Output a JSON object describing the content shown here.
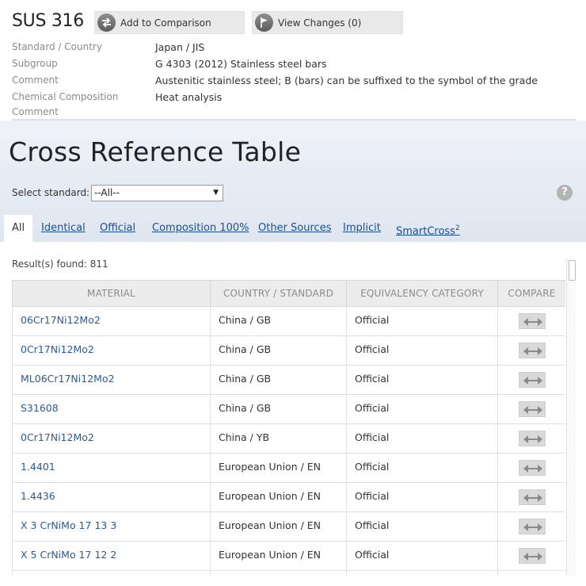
{
  "header": {
    "title": "SUS 316",
    "add_to_comparison": "Add to Comparison",
    "view_changes": "View Changes (0)"
  },
  "properties": [
    {
      "label": "Standard / Country",
      "value": "Japan / JIS"
    },
    {
      "label": "Subgroup",
      "value": "G 4303 (2012) Stainless steel bars"
    },
    {
      "label": "Comment",
      "value": "Austenitic stainless steel; B (bars) can be suffixed to the symbol of the grade"
    },
    {
      "label": "Chemical Composition",
      "value": "Heat analysis"
    },
    {
      "label": "Comment",
      "value": ""
    }
  ],
  "cross_reference": {
    "title": "Cross Reference Table",
    "select_label": "Select standard:",
    "select_value": "--All--",
    "help": "?"
  },
  "tabs": [
    {
      "label": "All",
      "sup": ""
    },
    {
      "label": "Identical",
      "sup": ""
    },
    {
      "label": "Official",
      "sup": ""
    },
    {
      "label": "Composition 100%",
      "sup": ""
    },
    {
      "label": "Other Sources",
      "sup": ""
    },
    {
      "label": "Implicit",
      "sup": ""
    },
    {
      "label": "SmartCross",
      "sup": "2"
    }
  ],
  "results": "Result(s) found: 811",
  "table": {
    "columns": [
      "MATERIAL",
      "COUNTRY / STANDARD",
      "EQUIVALENCY CATEGORY",
      "COMPARE"
    ],
    "rows": [
      {
        "material": "06Cr17Ni12Mo2",
        "country": "China / GB",
        "category": "Official"
      },
      {
        "material": "0Cr17Ni12Mo2",
        "country": "China / GB",
        "category": "Official"
      },
      {
        "material": "ML06Cr17Ni12Mo2",
        "country": "China / GB",
        "category": "Official"
      },
      {
        "material": "S31608",
        "country": "China / GB",
        "category": "Official"
      },
      {
        "material": "0Cr17Ni12Mo2",
        "country": "China / YB",
        "category": "Official"
      },
      {
        "material": "1.4401",
        "country": "European Union / EN",
        "category": "Official"
      },
      {
        "material": "1.4436",
        "country": "European Union / EN",
        "category": "Official"
      },
      {
        "material": "X 3 CrNiMo 17 13 3",
        "country": "European Union / EN",
        "category": "Official"
      },
      {
        "material": "X 5 CrNiMo 17 12 2",
        "country": "European Union / EN",
        "category": "Official"
      },
      {
        "material": "",
        "country": "",
        "category": ""
      }
    ]
  },
  "icons": {
    "compare_button": "swap-arrows-icon",
    "changes_button": "flag-icon",
    "row_compare": "compare-arrows-icon"
  }
}
